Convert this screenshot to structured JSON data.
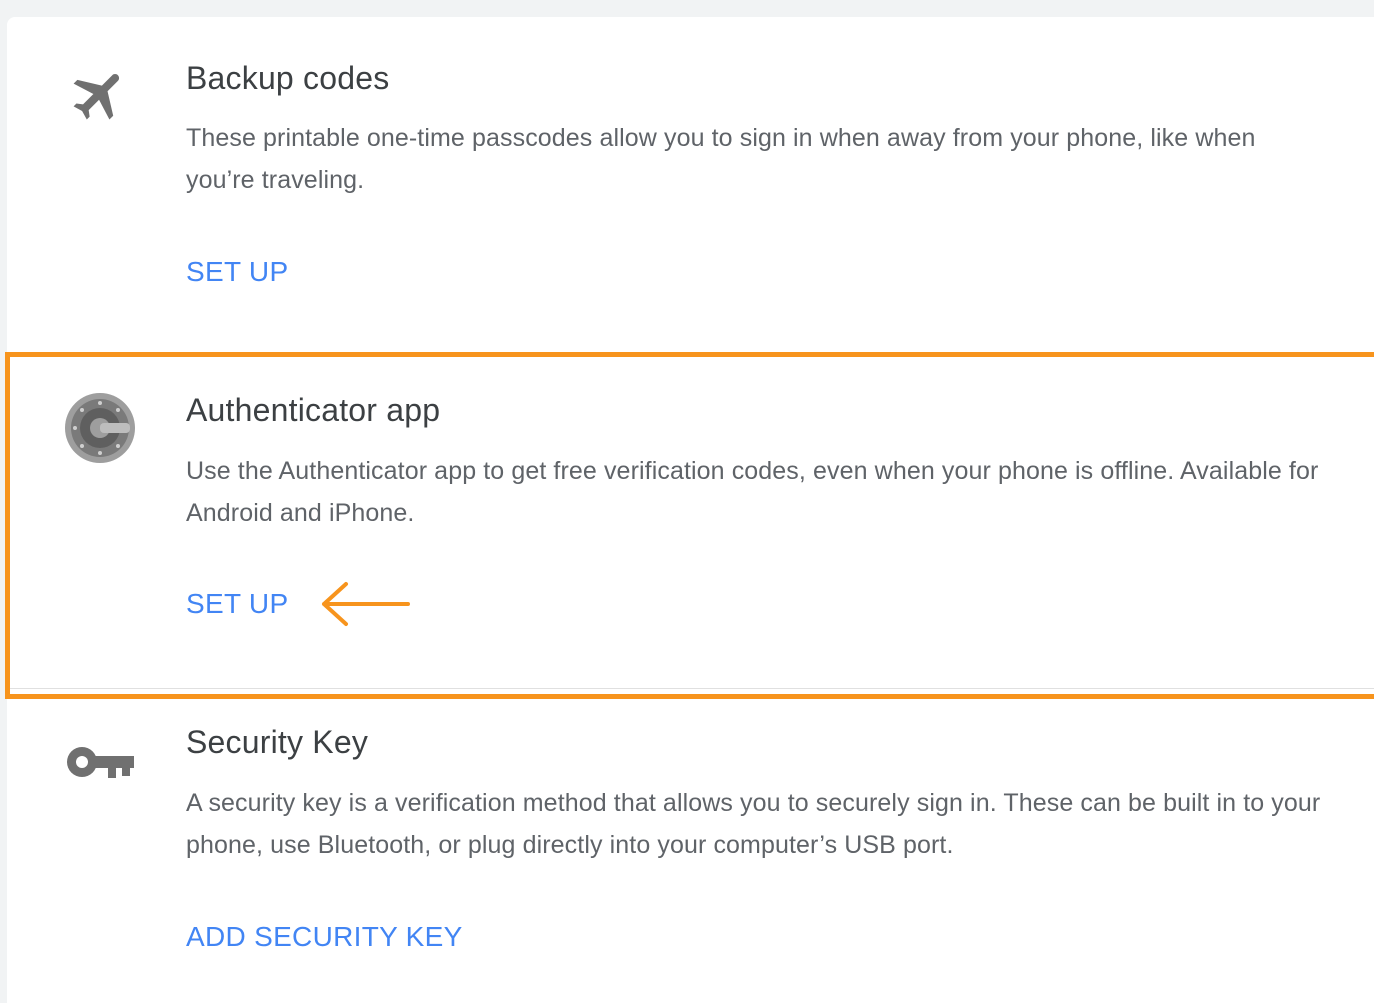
{
  "methods": [
    {
      "title": "Backup codes",
      "description": "These printable one-time passcodes allow you to sign in when away from your phone, like when you’re traveling.",
      "action": "SET UP",
      "icon": "airplane-icon"
    },
    {
      "title": "Authenticator app",
      "description": "Use the Authenticator app to get free verification codes, even when your phone is offline. Available for Android and iPhone.",
      "action": "SET UP",
      "icon": "google-authenticator-icon"
    },
    {
      "title": "Security Key",
      "description": "A security key is a verification method that allows you to securely sign in. These can be built in to your phone, use Bluetooth, or plug directly into your computer’s USB port.",
      "action": "ADD SECURITY KEY",
      "icon": "key-icon"
    }
  ],
  "annotation": {
    "highlight_color": "#f7941d",
    "highlighted_method": "Authenticator app",
    "arrow_icon": "left-arrow-icon"
  },
  "colors": {
    "accent": "#4285f4",
    "title": "#3c4043",
    "text": "#5f6368",
    "icon": "#707070"
  }
}
